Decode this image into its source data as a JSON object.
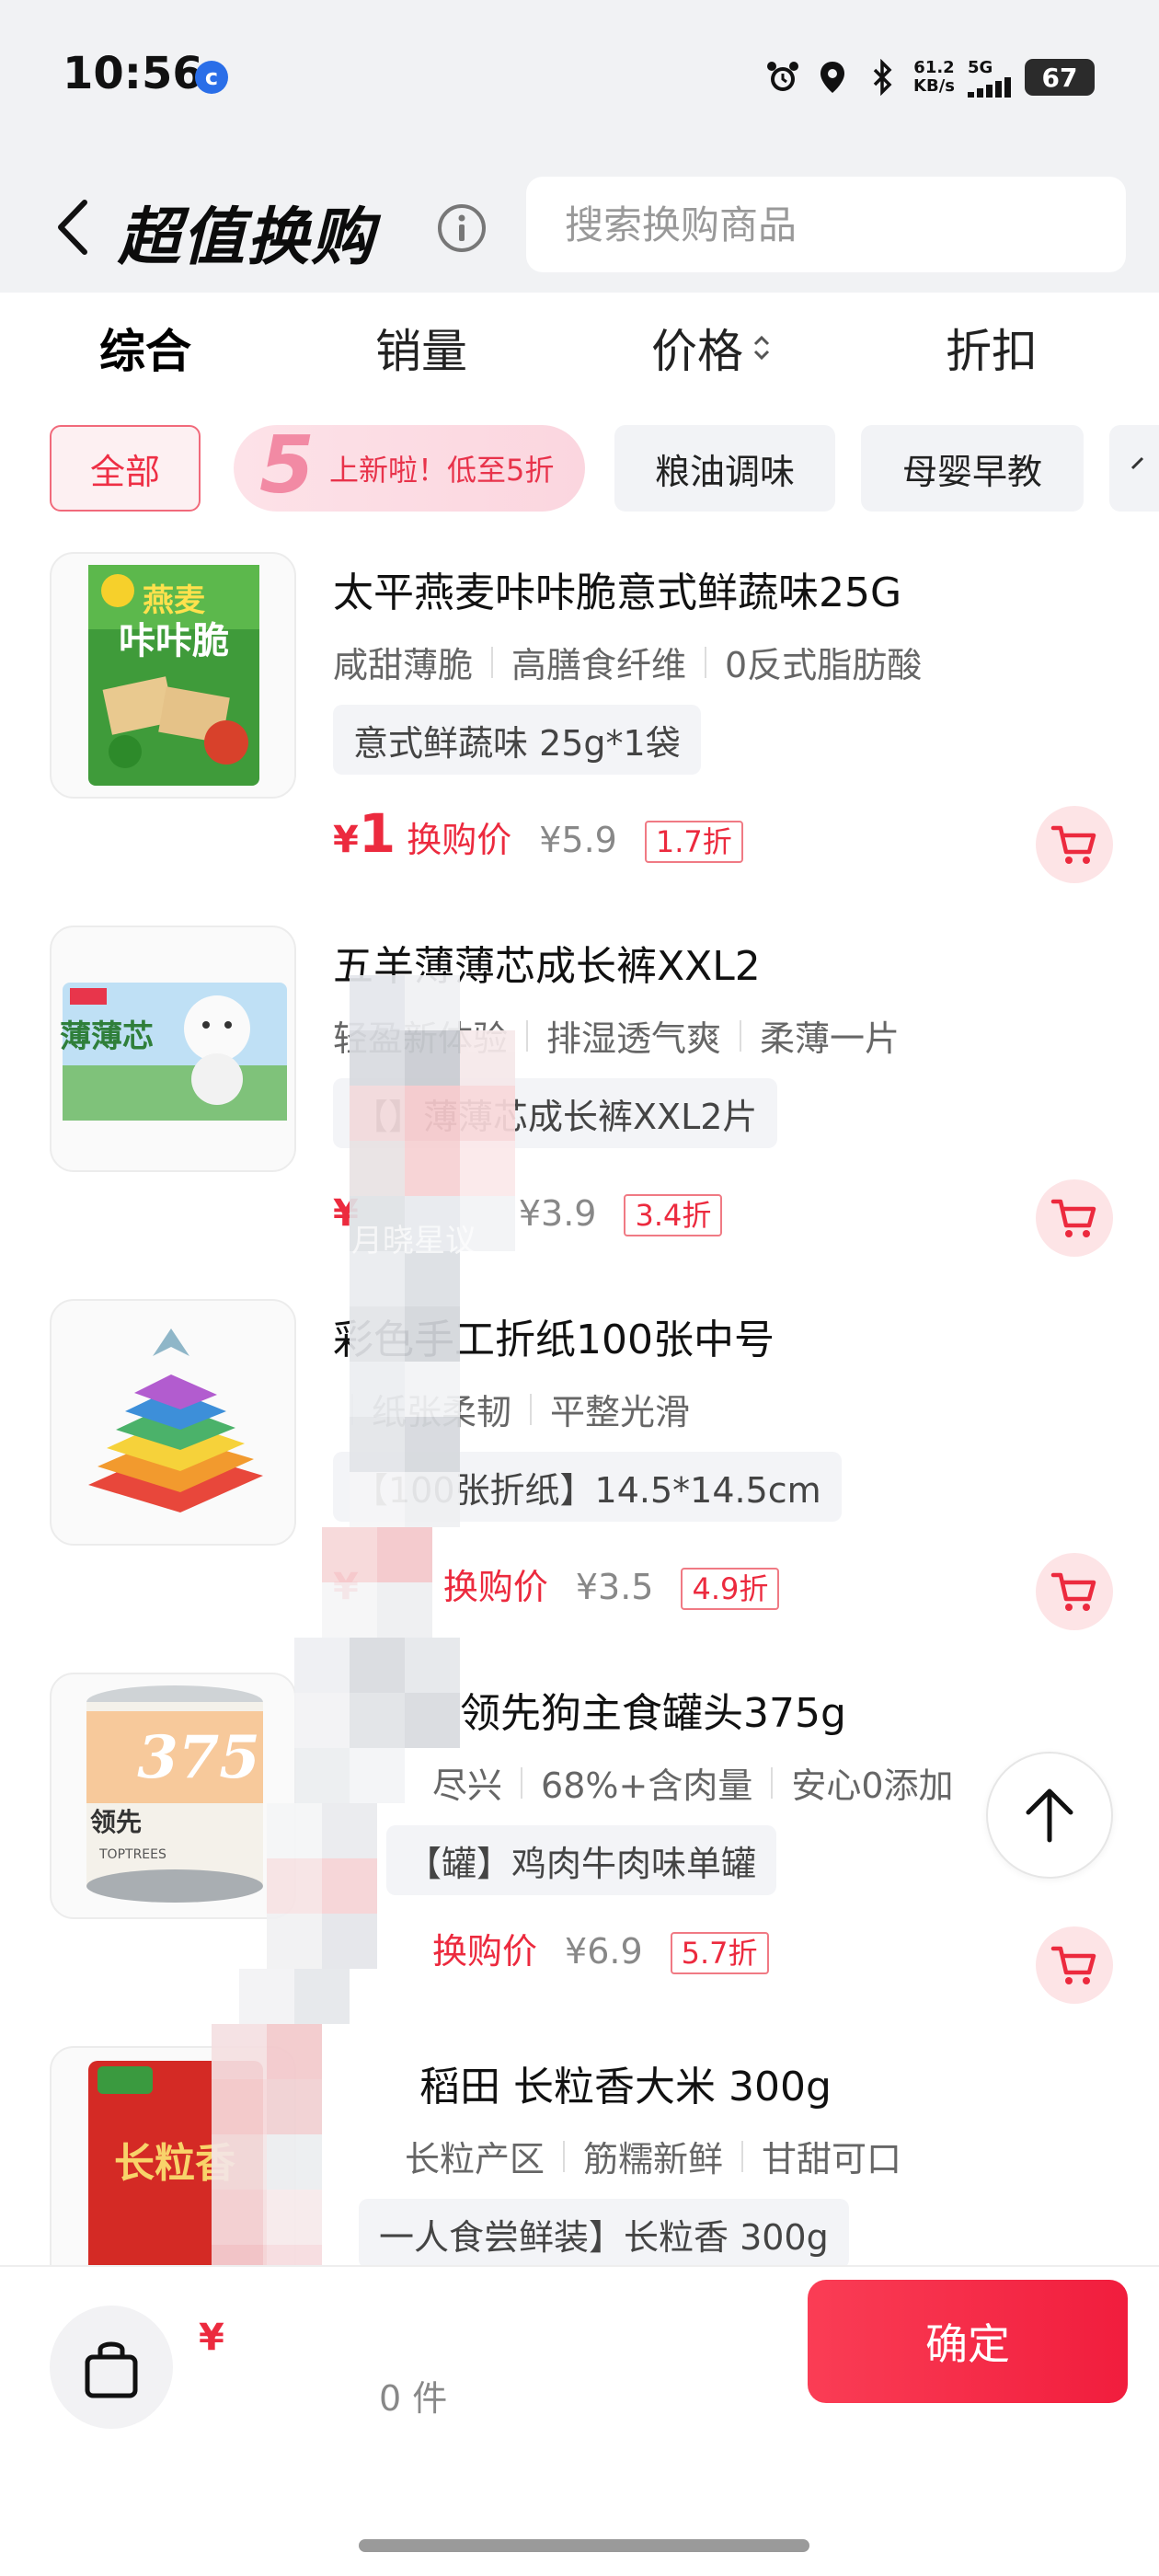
{
  "status_bar": {
    "time": "10:56",
    "app_badge": "c",
    "net_speed_value": "61.2",
    "net_speed_unit": "KB/s",
    "network": "5G",
    "battery": "67"
  },
  "header": {
    "title": "超值换购",
    "search_placeholder": "搜索换购商品"
  },
  "sort_tabs": [
    {
      "label": "综合",
      "active": true
    },
    {
      "label": "销量",
      "active": false
    },
    {
      "label": "价格",
      "active": false
    },
    {
      "label": "折扣",
      "active": false
    }
  ],
  "chips": [
    {
      "label": "全部",
      "active": true
    },
    {
      "label": "上新啦！低至5折",
      "promo_number": "5"
    },
    {
      "label": "粮油调味"
    },
    {
      "label": "母婴早教"
    }
  ],
  "products": [
    {
      "title": "太平燕麦咔咔脆意式鲜蔬味25G",
      "tags": [
        "咸甜薄脆",
        "高膳食纤维",
        "0反式脂肪酸"
      ],
      "spec": "意式鲜蔬味 25g*1袋",
      "price_symbol": "¥",
      "price": "1",
      "price_label": "换购价",
      "original_price": "¥5.9",
      "discount": "1.7折",
      "thumb_text_top": "燕麦",
      "thumb_text_main": "咔咔脆"
    },
    {
      "title": "五羊薄薄芯成长裤XXL2",
      "tags": [
        "轻盈新体验",
        "排湿透气爽",
        "柔薄一片"
      ],
      "spec": "【】薄薄芯成长裤XXL2片",
      "price_symbol": "¥",
      "price": "",
      "price_label": "",
      "original_price": "¥3.9",
      "discount": "3.4折",
      "thumb_text_main": "薄薄芯"
    },
    {
      "title": "彩色手工折纸100张中号",
      "tags": [
        "",
        "纸张柔韧",
        "平整光滑"
      ],
      "spec": "【100张折纸】14.5*14.5cm",
      "price_symbol": "¥",
      "price": "",
      "price_label": "换购价",
      "original_price": "¥3.5",
      "discount": "4.9折"
    },
    {
      "title": "领先狗主食罐头375g",
      "tags": [
        "尽兴",
        "68%+含肉量",
        "安心0添加"
      ],
      "spec": "【罐】鸡肉牛肉味单罐",
      "price_symbol": "¥",
      "price": "",
      "price_label": "换购价",
      "original_price": "¥6.9",
      "discount": "5.7折",
      "thumb_number": "375",
      "thumb_brand": "TOPTREES",
      "thumb_text_main": "领先"
    },
    {
      "title": "稻田 长粒香大米 300g",
      "tags": [
        "长粒产区",
        "筋糯新鲜",
        "甘甜可口"
      ],
      "spec": "一人食尝鲜装】长粒香 300g",
      "thumb_text_main": "长粒香"
    }
  ],
  "watermark": "月晓星议",
  "bottom_bar": {
    "total_symbol": "¥",
    "selected_count": "0 件",
    "confirm_label": "确定"
  }
}
